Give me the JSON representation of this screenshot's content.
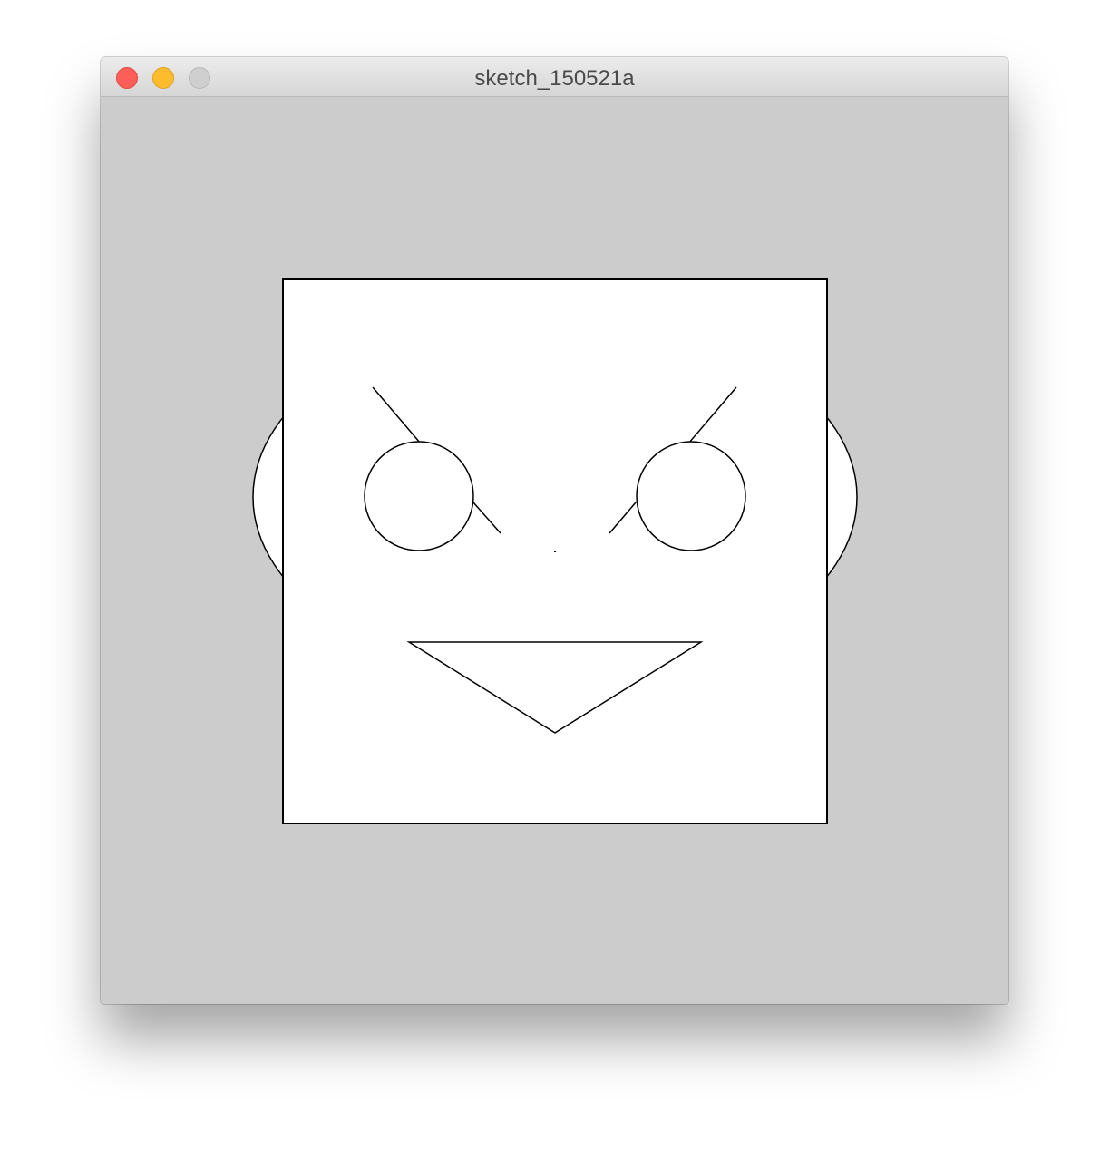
{
  "window": {
    "title": "sketch_150521a",
    "controls": {
      "close": "close-button",
      "minimize": "minimize-button",
      "zoom": "zoom-button"
    }
  },
  "colors": {
    "canvas_background": "#cccccc",
    "shape_fill": "#ffffff",
    "stroke": "#000000",
    "close": "#fc5f57",
    "minimize": "#fdbc2e",
    "zoom_disabled": "#cfcfcf"
  }
}
